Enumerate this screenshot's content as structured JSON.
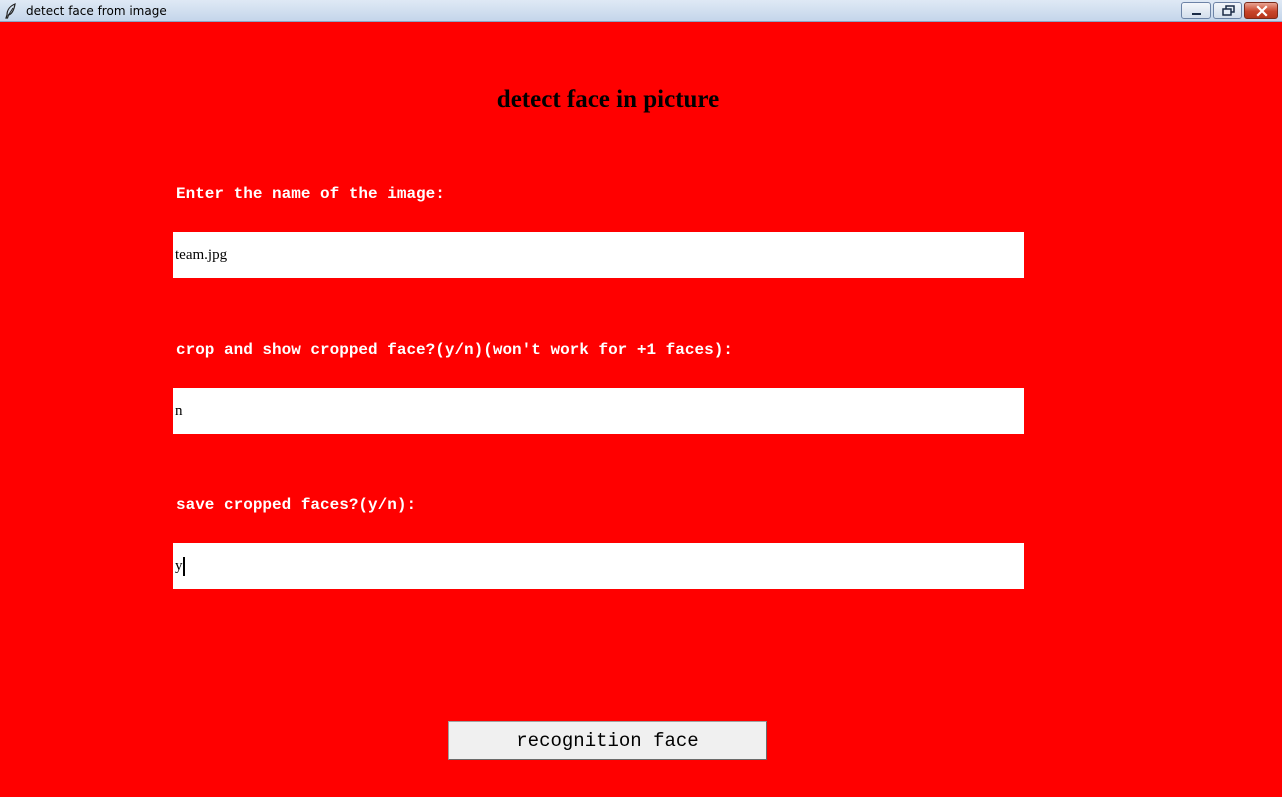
{
  "window": {
    "title": "detect face from image",
    "icon": "feather-icon",
    "controls": [
      "minimize-icon",
      "restore-icon",
      "close-icon"
    ]
  },
  "colors": {
    "background": "#ff0000",
    "label_text": "#ffffff",
    "heading_text": "#000000",
    "entry_background": "#ffffff",
    "button_background": "#f0f0f0"
  },
  "main": {
    "heading": "detect face in picture",
    "fields": [
      {
        "label": "Enter the name of the image:",
        "value": "team.jpg"
      },
      {
        "label": "crop and show cropped face?(y/n)(won't work for +1 faces):",
        "value": "n"
      },
      {
        "label": "save cropped faces?(y/n):",
        "value": "y"
      }
    ],
    "submit_label": "recognition face"
  }
}
